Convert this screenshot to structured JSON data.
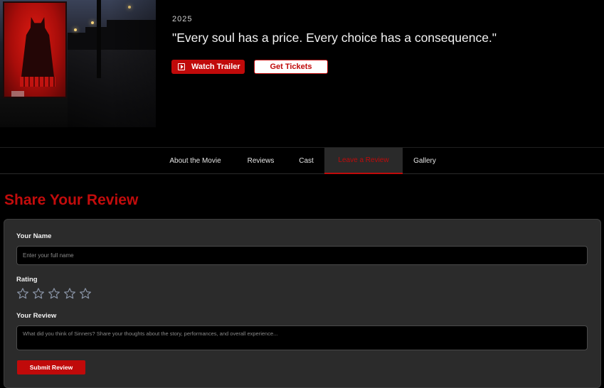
{
  "hero": {
    "year": "2025",
    "tagline": "\"Every soul has a price. Every choice has a consequence.\"",
    "watch_trailer_label": "Watch Trailer",
    "get_tickets_label": "Get Tickets"
  },
  "nav": {
    "tabs": [
      {
        "label": "About the Movie"
      },
      {
        "label": "Reviews"
      },
      {
        "label": "Cast"
      },
      {
        "label": "Leave a Review",
        "active": true
      },
      {
        "label": "Gallery"
      }
    ]
  },
  "review_form": {
    "title": "Share Your Review",
    "name_label": "Your Name",
    "name_placeholder": "Enter your full name",
    "rating_label": "Rating",
    "rating_value": 0,
    "rating_max": 5,
    "review_label": "Your Review",
    "review_placeholder": "What did you think of Sinners? Share your thoughts about the story, performances, and overall experience...",
    "submit_label": "Submit Review"
  },
  "colors": {
    "accent": "#c00a0a",
    "background": "#000000",
    "card": "#2b2b2b",
    "star_outline": "#8a94a6"
  },
  "icons": {
    "trailer": "play-icon",
    "rating": "star-outline-icon"
  }
}
